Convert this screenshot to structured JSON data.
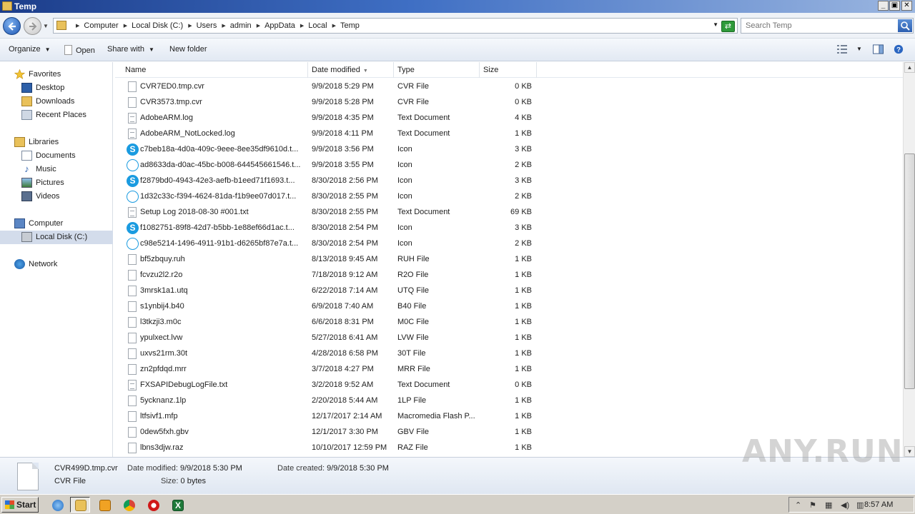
{
  "window": {
    "title": "Temp"
  },
  "address": {
    "crumbs": [
      "Computer",
      "Local Disk (C:)",
      "Users",
      "admin",
      "AppData",
      "Local",
      "Temp"
    ],
    "search_placeholder": "Search Temp"
  },
  "toolbar": {
    "organize": "Organize",
    "open": "Open",
    "share_with": "Share with",
    "new_folder": "New folder"
  },
  "sidebar": {
    "favorites": "Favorites",
    "favorites_items": [
      "Desktop",
      "Downloads",
      "Recent Places"
    ],
    "libraries": "Libraries",
    "libraries_items": [
      "Documents",
      "Music",
      "Pictures",
      "Videos"
    ],
    "computer": "Computer",
    "computer_items": [
      "Local Disk (C:)"
    ],
    "network": "Network"
  },
  "columns": {
    "name": "Name",
    "date": "Date modified",
    "type": "Type",
    "size": "Size"
  },
  "files": [
    {
      "name": "CVR7ED0.tmp.cvr",
      "date": "9/9/2018 5:29 PM",
      "type": "CVR File",
      "size": "0 KB",
      "icon": "file"
    },
    {
      "name": "CVR3573.tmp.cvr",
      "date": "9/9/2018 5:28 PM",
      "type": "CVR File",
      "size": "0 KB",
      "icon": "file"
    },
    {
      "name": "AdobeARM.log",
      "date": "9/9/2018 4:35 PM",
      "type": "Text Document",
      "size": "4 KB",
      "icon": "text"
    },
    {
      "name": "AdobeARM_NotLocked.log",
      "date": "9/9/2018 4:11 PM",
      "type": "Text Document",
      "size": "1 KB",
      "icon": "text"
    },
    {
      "name": "c7beb18a-4d0a-409c-9eee-8ee35df9610d.t...",
      "date": "9/9/2018 3:56 PM",
      "type": "Icon",
      "size": "3 KB",
      "icon": "skype"
    },
    {
      "name": "ad8633da-d0ac-45bc-b008-644545661546.t...",
      "date": "9/9/2018 3:55 PM",
      "type": "Icon",
      "size": "2 KB",
      "icon": "skype-outline"
    },
    {
      "name": "f2879bd0-4943-42e3-aefb-b1eed71f1693.t...",
      "date": "8/30/2018 2:56 PM",
      "type": "Icon",
      "size": "3 KB",
      "icon": "skype"
    },
    {
      "name": "1d32c33c-f394-4624-81da-f1b9ee07d017.t...",
      "date": "8/30/2018 2:55 PM",
      "type": "Icon",
      "size": "2 KB",
      "icon": "skype-outline"
    },
    {
      "name": "Setup Log 2018-08-30 #001.txt",
      "date": "8/30/2018 2:55 PM",
      "type": "Text Document",
      "size": "69 KB",
      "icon": "text"
    },
    {
      "name": "f1082751-89f8-42d7-b5bb-1e88ef66d1ac.t...",
      "date": "8/30/2018 2:54 PM",
      "type": "Icon",
      "size": "3 KB",
      "icon": "skype"
    },
    {
      "name": "c98e5214-1496-4911-91b1-d6265bf87e7a.t...",
      "date": "8/30/2018 2:54 PM",
      "type": "Icon",
      "size": "2 KB",
      "icon": "skype-outline"
    },
    {
      "name": "bf5zbquy.ruh",
      "date": "8/13/2018 9:45 AM",
      "type": "RUH File",
      "size": "1 KB",
      "icon": "file"
    },
    {
      "name": "fcvzu2l2.r2o",
      "date": "7/18/2018 9:12 AM",
      "type": "R2O File",
      "size": "1 KB",
      "icon": "file"
    },
    {
      "name": "3mrsk1a1.utq",
      "date": "6/22/2018 7:14 AM",
      "type": "UTQ File",
      "size": "1 KB",
      "icon": "file"
    },
    {
      "name": "s1ynbij4.b40",
      "date": "6/9/2018 7:40 AM",
      "type": "B40 File",
      "size": "1 KB",
      "icon": "file"
    },
    {
      "name": "l3tkzji3.m0c",
      "date": "6/6/2018 8:31 PM",
      "type": "M0C File",
      "size": "1 KB",
      "icon": "file"
    },
    {
      "name": "ypulxect.lvw",
      "date": "5/27/2018 6:41 AM",
      "type": "LVW File",
      "size": "1 KB",
      "icon": "file"
    },
    {
      "name": "uxvs21rm.30t",
      "date": "4/28/2018 6:58 PM",
      "type": "30T File",
      "size": "1 KB",
      "icon": "file"
    },
    {
      "name": "zn2pfdqd.mrr",
      "date": "3/7/2018 4:27 PM",
      "type": "MRR File",
      "size": "1 KB",
      "icon": "file"
    },
    {
      "name": "FXSAPIDebugLogFile.txt",
      "date": "3/2/2018 9:52 AM",
      "type": "Text Document",
      "size": "0 KB",
      "icon": "text"
    },
    {
      "name": "5ycknanz.1lp",
      "date": "2/20/2018 5:44 AM",
      "type": "1LP File",
      "size": "1 KB",
      "icon": "file"
    },
    {
      "name": "ltfsivf1.mfp",
      "date": "12/17/2017 2:14 AM",
      "type": "Macromedia Flash P...",
      "size": "1 KB",
      "icon": "file"
    },
    {
      "name": "0dew5fxh.gbv",
      "date": "12/1/2017 3:30 PM",
      "type": "GBV File",
      "size": "1 KB",
      "icon": "file"
    },
    {
      "name": "lbns3djw.raz",
      "date": "10/10/2017 12:59 PM",
      "type": "RAZ File",
      "size": "1 KB",
      "icon": "file"
    }
  ],
  "details": {
    "filename": "CVR499D.tmp.cvr",
    "filetype": "CVR File",
    "modified_label": "Date modified:",
    "modified": "9/9/2018 5:30 PM",
    "created_label": "Date created:",
    "created": "9/9/2018 5:30 PM",
    "size_label": "Size:",
    "size": "0 bytes"
  },
  "watermark": "ANY.RUN",
  "taskbar": {
    "start": "Start",
    "clock": "8:57 AM"
  }
}
